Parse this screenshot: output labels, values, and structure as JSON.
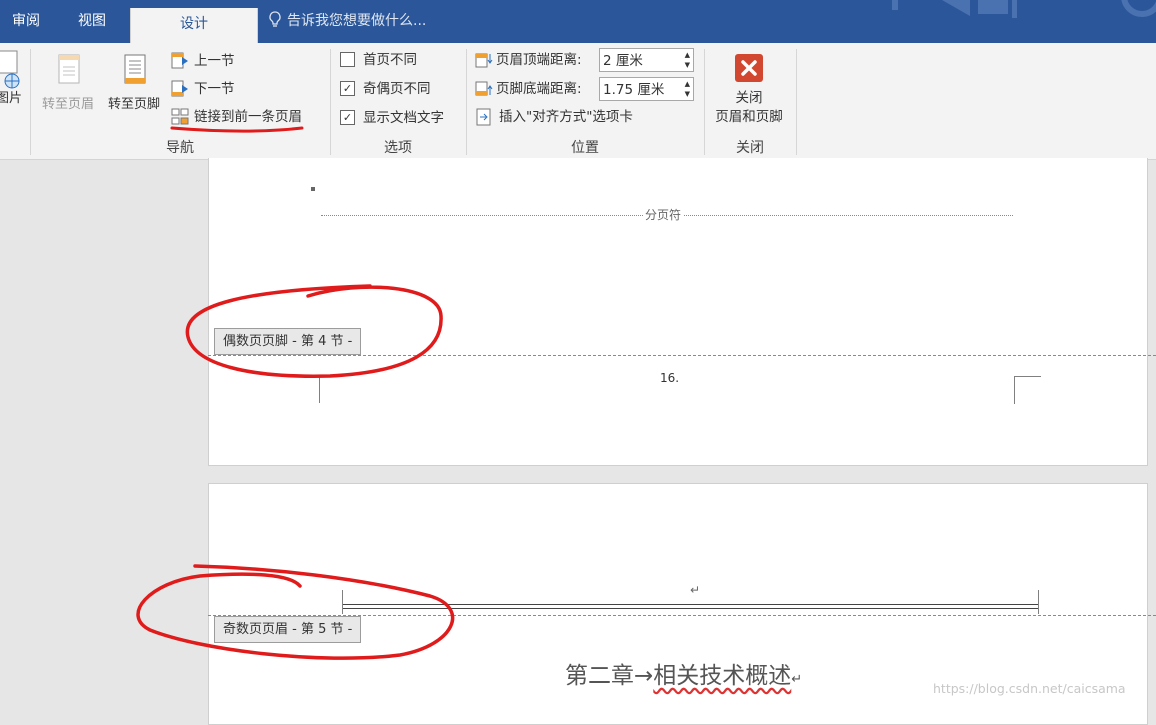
{
  "tabs": {
    "review": "审阅",
    "view": "视图",
    "design": "设计",
    "tell_me": "告诉我您想要做什么..."
  },
  "ribbon": {
    "picture_partial": "图片",
    "goto_header": "转至页眉",
    "goto_footer": "转至页脚",
    "prev_section": "上一节",
    "next_section": "下一节",
    "link_previous": "链接到前一条页眉",
    "nav_group": "导航",
    "options": {
      "first_page": {
        "label": "首页不同",
        "checked": false
      },
      "odd_even": {
        "label": "奇偶页不同",
        "checked": true
      },
      "show_text": {
        "label": "显示文档文字",
        "checked": true
      }
    },
    "options_group": "选项",
    "header_top_label": "页眉顶端距离:",
    "header_top_value": "2 厘米",
    "footer_bottom_label": "页脚底端距离:",
    "footer_bottom_value": "1.75 厘米",
    "insert_align_tab": "插入\"对齐方式\"选项卡",
    "position_group": "位置",
    "close_line1": "关闭",
    "close_line2": "页眉和页脚",
    "close_group": "关闭"
  },
  "document": {
    "page_break": "分页符",
    "even_footer_tag": "偶数页页脚 - 第 4 节 -",
    "page_number": "16.",
    "odd_header_tag": "奇数页页眉 - 第 5 节 -",
    "chapter_title_prefix": "第二章→",
    "chapter_title_main": "相关技术概述",
    "paragraph_mark": "↵"
  },
  "watermark": "https://blog.csdn.net/caicsama",
  "colors": {
    "ribbon_blue": "#2b579a",
    "close_red": "#d2472f",
    "annotation_red": "#e01b1b",
    "accent_orange": "#f0a030"
  }
}
